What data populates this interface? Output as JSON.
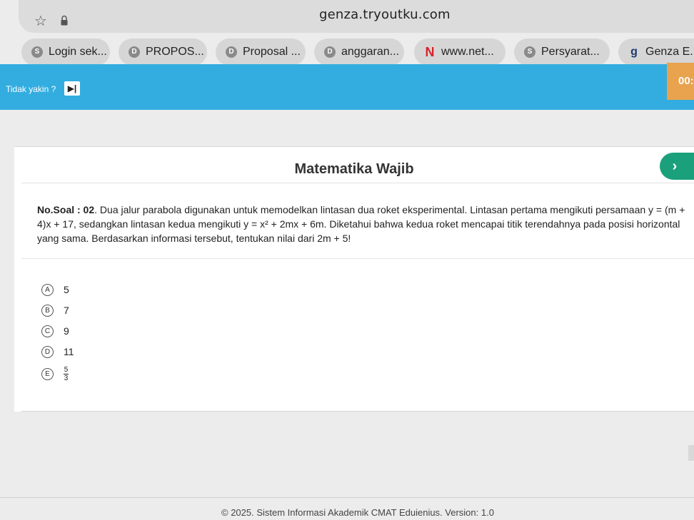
{
  "browser": {
    "url": "genza.tryoutku.com",
    "tab_overflow": "..",
    "bookmarks": [
      {
        "label": "Login sek...",
        "icon": "S"
      },
      {
        "label": "PROPOS...",
        "icon": "D"
      },
      {
        "label": "Proposal ...",
        "icon": "D"
      },
      {
        "label": "anggaran...",
        "icon": "D"
      },
      {
        "label": "www.net...",
        "icon": "N"
      },
      {
        "label": "Persyarat...",
        "icon": "S"
      },
      {
        "label": "Genza E.",
        "icon": "g"
      }
    ]
  },
  "header": {
    "unsure_label": "Tidak yakin ?",
    "unsure_toggle": "▶|",
    "timer": "00:",
    "color": "#33ade0",
    "timer_color": "#e9a24d"
  },
  "exam": {
    "subject": "Matematika Wajib",
    "next_symbol": "›",
    "question_label": "No.Soal : 02",
    "question_text_1": ". Dua jalur parabola digunakan untuk memodelkan lintasan dua roket eksperimental. Lintasan pertama mengikuti persamaan y = (m + 4)x + 17, sedangkan lintasan kedua mengikuti y = x² + 2mx + 6m. Diketahui bahwa kedua roket mencapai titik terendahnya pada posisi horizontal yang sama. Berdasarkan informasi tersebut, tentukan nilai dari 2m + 5!",
    "options": [
      {
        "letter": "A",
        "value": "5"
      },
      {
        "letter": "B",
        "value": "7"
      },
      {
        "letter": "C",
        "value": "9"
      },
      {
        "letter": "D",
        "value": "11"
      },
      {
        "letter": "E",
        "numerator": "5",
        "denominator": "3"
      }
    ]
  },
  "footer": {
    "text": "© 2025. Sistem Informasi Akademik CMAT Eduienius. Version: 1.0"
  }
}
